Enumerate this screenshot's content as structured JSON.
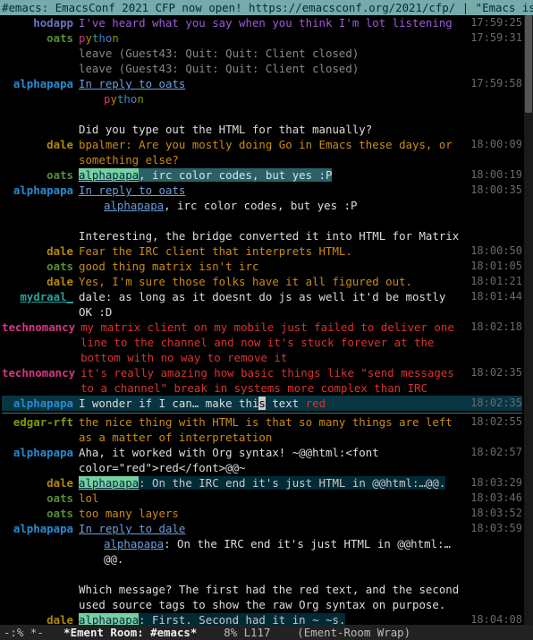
{
  "topic": "#emacs: EmacsConf 2021 CFP now open! https://emacsconf.org/2021/cfp/ | \"Emacs is a co",
  "scrollbar": {
    "top_pct": 0,
    "height_pct": 16
  },
  "modeline": {
    "left": "-:% *-",
    "buffer": "*Ement Room: #emacs*",
    "pos": "8% L117",
    "mode": "(Ement-Room Wrap)"
  },
  "lines": [
    {
      "nick": "hodapp",
      "nick_cls": "nick-hodapp",
      "ts": "17:59:25",
      "body": [
        {
          "t": "I've heard what you say when you think I'm lot listening",
          "cls": "msg-purple"
        }
      ]
    },
    {
      "nick": "oats",
      "nick_cls": "nick-oats",
      "ts": "17:59:31",
      "body": [
        {
          "t": "python",
          "cls": "pyth"
        }
      ]
    },
    {
      "nick": "",
      "nick_cls": "",
      "ts": "",
      "body": [
        {
          "t": "leave (Guest43: Quit: Quit: Client closed)",
          "cls": "msg-grey"
        }
      ]
    },
    {
      "nick": "",
      "nick_cls": "",
      "ts": "",
      "body": [
        {
          "t": "leave (Guest43: Quit: Quit: Client closed)",
          "cls": "msg-grey"
        }
      ]
    },
    {
      "nick": "alphapapa",
      "nick_cls": "nick-alphapapa",
      "ts": "17:59:58",
      "body": [
        {
          "t": "In reply to ",
          "cls": "link"
        },
        {
          "t": "oats",
          "cls": "link"
        }
      ]
    },
    {
      "nick": "",
      "nick_cls": "",
      "ts": "",
      "body": [
        {
          "t": "python",
          "cls": "pyth indent"
        }
      ]
    },
    {
      "spacer": true
    },
    {
      "nick": "",
      "nick_cls": "",
      "ts": "",
      "body": [
        {
          "t": "Did you type out the HTML for that manually?",
          "cls": "msg-white"
        }
      ]
    },
    {
      "nick": "dale",
      "nick_cls": "nick-dale",
      "ts": "18:00:09",
      "body": [
        {
          "t": "bpalmer: Are you mostly doing Go in Emacs these days, or something else?",
          "cls": "msg-orange"
        }
      ]
    },
    {
      "nick": "oats",
      "nick_cls": "nick-oats",
      "ts": "18:00:19",
      "body": [
        {
          "t": "alphapapa",
          "cls": "hl-nick-ap"
        },
        {
          "t": ", irc color codes, but yes :P",
          "cls": "hl-wrap-msg"
        }
      ]
    },
    {
      "nick": "alphapapa",
      "nick_cls": "nick-alphapapa",
      "ts": "18:00:35",
      "body": [
        {
          "t": "In reply to ",
          "cls": "link"
        },
        {
          "t": "oats",
          "cls": "link"
        }
      ]
    },
    {
      "nick": "",
      "nick_cls": "",
      "ts": "",
      "body": [
        {
          "t": "alphapapa",
          "cls": "link indent-lead",
          "indent": true
        },
        {
          "t": ", irc color codes, but yes :P",
          "cls": "msg-white"
        }
      ]
    },
    {
      "spacer": true
    },
    {
      "nick": "",
      "nick_cls": "",
      "ts": "",
      "body": [
        {
          "t": "Interesting, the bridge converted it into HTML for Matrix",
          "cls": "msg-white"
        }
      ]
    },
    {
      "nick": "dale",
      "nick_cls": "nick-dale",
      "ts": "18:00:50",
      "body": [
        {
          "t": "Fear the IRC client that interprets HTML.",
          "cls": "msg-orange"
        }
      ]
    },
    {
      "nick": "oats",
      "nick_cls": "nick-oats",
      "ts": "18:01:05",
      "body": [
        {
          "t": "good thing matrix isn't irc",
          "cls": "msg-orange"
        }
      ]
    },
    {
      "nick": "dale",
      "nick_cls": "nick-dale",
      "ts": "18:01:21",
      "body": [
        {
          "t": "Yes, I'm sure those folks have it all figured out.",
          "cls": "msg-orange"
        }
      ]
    },
    {
      "nick": "mydraal_",
      "nick_cls": "nick-mydraal",
      "ts": "18:01:44",
      "body": [
        {
          "t": "dale: as long as it doesnt do js as well it'd be mostly OK :D",
          "cls": "msg-white"
        }
      ]
    },
    {
      "nick": "technomancy",
      "nick_cls": "nick-technomancy",
      "ts": "18:02:18",
      "body": [
        {
          "t": "my matrix client on my mobile just failed to deliver one line to the channel and now it's stuck forever at the bottom with no way to remove it",
          "cls": "msg-red"
        }
      ]
    },
    {
      "nick": "technomancy",
      "nick_cls": "nick-technomancy",
      "ts": "18:02:35",
      "body": [
        {
          "t": "it's really amazing how basic things like \"send messages to a channel\" break in systems more complex than IRC",
          "cls": "msg-red"
        }
      ]
    },
    {
      "nick": "alphapapa",
      "nick_cls": "nick-alphapapa",
      "ts": "18:02:35",
      "hl_line": true,
      "body": [
        {
          "t": "I wonder if I can… make thi",
          "cls": "msg-white"
        },
        {
          "t": "s",
          "cls": "cursor"
        },
        {
          "t": " text ",
          "cls": "msg-white"
        },
        {
          "t": "red",
          "cls": "msg-red"
        }
      ]
    },
    {
      "hr": true
    },
    {
      "nick": "edgar-rft",
      "nick_cls": "nick-edgar",
      "ts": "18:02:55",
      "body": [
        {
          "t": "the nice thing with HTML is that so many things are left as a matter of interpretation",
          "cls": "msg-orange"
        }
      ]
    },
    {
      "nick": "alphapapa",
      "nick_cls": "nick-alphapapa",
      "ts": "18:02:57",
      "body": [
        {
          "t": "Aha, it worked with Org syntax!  ~@@html:<font color=\"red\">red</font>@@~",
          "cls": "msg-white"
        }
      ]
    },
    {
      "nick": "dale",
      "nick_cls": "nick-dale",
      "ts": "18:03:29",
      "body": [
        {
          "t": "alphapapa",
          "cls": "hl-nick-ap"
        },
        {
          "t": ": On the IRC end it's just HTML in @@html:…@@.",
          "cls": "hl-wrap-dark"
        }
      ]
    },
    {
      "nick": "oats",
      "nick_cls": "nick-oats",
      "ts": "18:03:46",
      "body": [
        {
          "t": "lol",
          "cls": "msg-orange"
        }
      ]
    },
    {
      "nick": "oats",
      "nick_cls": "nick-oats",
      "ts": "18:03:52",
      "body": [
        {
          "t": "too many layers",
          "cls": "msg-orange"
        }
      ]
    },
    {
      "nick": "alphapapa",
      "nick_cls": "nick-alphapapa",
      "ts": "18:03:59",
      "body": [
        {
          "t": "In reply to ",
          "cls": "link"
        },
        {
          "t": "dale",
          "cls": "link"
        }
      ]
    },
    {
      "nick": "",
      "nick_cls": "",
      "ts": "",
      "body": [
        {
          "t": "alphapapa",
          "cls": "link indent-lead",
          "indent": true
        },
        {
          "t": ": On the IRC end it's just HTML in @@html:…@@.",
          "cls": "msg-white"
        }
      ]
    },
    {
      "spacer": true
    },
    {
      "nick": "",
      "nick_cls": "",
      "ts": "",
      "body": [
        {
          "t": "Which message? The first had the red text, and the second used source tags to show the raw Org syntax on purpose.",
          "cls": "msg-white"
        }
      ]
    },
    {
      "nick": "dale",
      "nick_cls": "nick-dale",
      "ts": "18:04:08",
      "body": [
        {
          "t": "alphapapa",
          "cls": "hl-nick-ap-noul"
        },
        {
          "t": ": First. Second had it in ~ ~s.",
          "cls": "hl-wrap-dark"
        }
      ]
    }
  ]
}
